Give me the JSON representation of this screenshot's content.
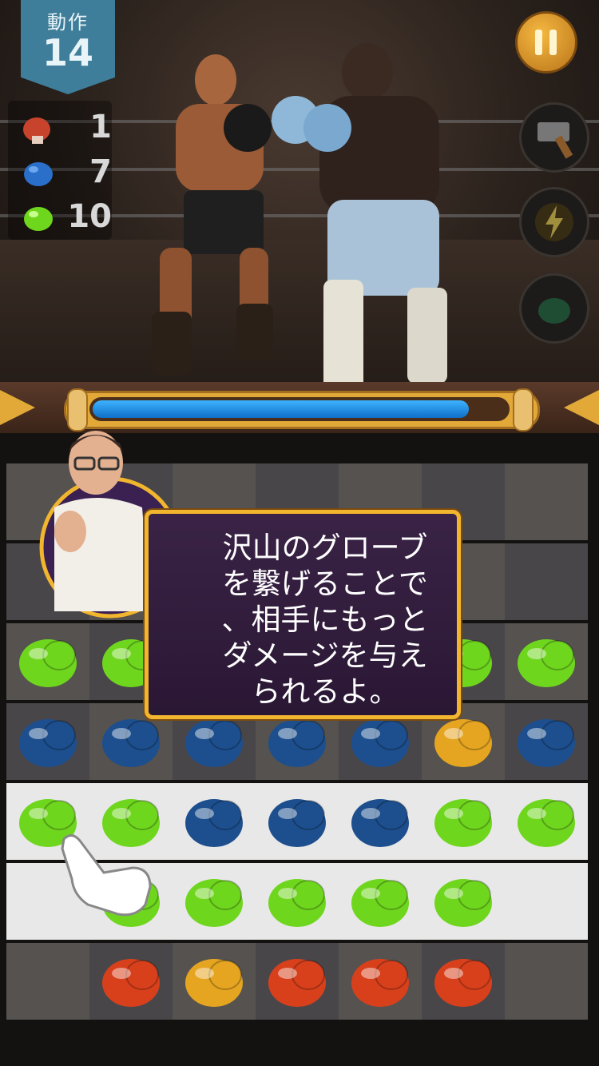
{
  "hud": {
    "moves_label": "動作",
    "moves_value": "14"
  },
  "goals": [
    {
      "icon": "red-glove-icon",
      "count": "1"
    },
    {
      "icon": "blue-glove-icon",
      "count": "7"
    },
    {
      "icon": "green-glove-icon",
      "count": "10"
    }
  ],
  "boosters": [
    "hammer-icon",
    "lightning-icon",
    "glove-swap-icon"
  ],
  "health_bar": {
    "fill": 0.91
  },
  "tutorial": {
    "line1": "沢山のグローブ",
    "line2": "を繋げることで",
    "line3": "、相手にもっと",
    "line4": "ダメージを与え",
    "line5": "られるよ。"
  },
  "colors": {
    "red": "#d8401c",
    "green": "#6fd61e",
    "blue": "#1d4f8e",
    "yellow": "#e5a521"
  },
  "board": [
    [
      "",
      "",
      "",
      "",
      "",
      "",
      ""
    ],
    [
      "",
      "",
      "",
      "",
      "",
      "",
      ""
    ],
    [
      "green",
      "green",
      "",
      "",
      "",
      "green",
      "green"
    ],
    [
      "blue",
      "blue",
      "blue",
      "blue",
      "blue",
      "yellow",
      "blue"
    ],
    [
      "green",
      "green",
      "blue",
      "blue",
      "blue",
      "green",
      "green"
    ],
    [
      "",
      "green",
      "green",
      "green",
      "green",
      "green",
      ""
    ],
    [
      "",
      "red",
      "yellow",
      "red",
      "red",
      "red",
      ""
    ]
  ],
  "highlight_rows": [
    4,
    5
  ]
}
